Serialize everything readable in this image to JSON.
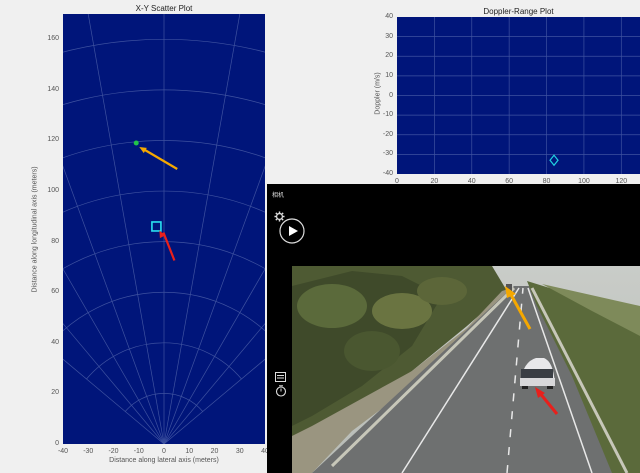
{
  "scatter": {
    "title": "X-Y Scatter Plot",
    "xlabel": "Distance along lateral axis (meters)",
    "ylabel": "Distance along longitudinal axis (meters)",
    "xticks": [
      "-40",
      "-30",
      "-20",
      "-10",
      "0",
      "10",
      "20",
      "30",
      "40"
    ],
    "yticks": [
      "0",
      "20",
      "40",
      "60",
      "80",
      "100",
      "120",
      "140",
      "160"
    ]
  },
  "doppler": {
    "title": "Doppler-Range Plot",
    "ylabel": "Doppler (m/s)",
    "xticks": [
      "0",
      "20",
      "40",
      "60",
      "80",
      "100",
      "120"
    ],
    "yticks": [
      "40",
      "30",
      "20",
      "10",
      "0",
      "-10",
      "-20",
      "-30",
      "-40"
    ]
  },
  "player": {
    "overlay_text": "相机",
    "icons": [
      "gear-icon",
      "play-icon",
      "menu-icon",
      "timer-icon"
    ]
  },
  "chart_data": [
    {
      "type": "scatter",
      "title": "X-Y Scatter Plot",
      "xlabel": "Distance along lateral axis (meters)",
      "ylabel": "Distance along longitudinal axis (meters)",
      "xlim": [
        -40,
        40
      ],
      "ylim": [
        0,
        170
      ],
      "grid": "polar",
      "series": [
        {
          "marker": "dot",
          "color": "#21c44a",
          "x": [
            -11
          ],
          "y": [
            119
          ]
        },
        {
          "marker": "square",
          "color": "#29e0f0",
          "x": [
            -3
          ],
          "y": [
            86
          ]
        }
      ],
      "annotations": [
        {
          "type": "arrow",
          "color": "#f5a800",
          "target": [
            -11,
            119
          ]
        },
        {
          "type": "arrow",
          "color": "#e8201c",
          "target": [
            -3,
            86
          ]
        }
      ]
    },
    {
      "type": "scatter",
      "title": "Doppler-Range Plot",
      "ylabel": "Doppler (m/s)",
      "xlim": [
        0,
        130
      ],
      "ylim": [
        -40,
        40
      ],
      "grid": true,
      "series": [
        {
          "marker": "diamond",
          "color": "#20d0e0",
          "x": [
            84
          ],
          "y": [
            -33
          ]
        }
      ]
    }
  ]
}
